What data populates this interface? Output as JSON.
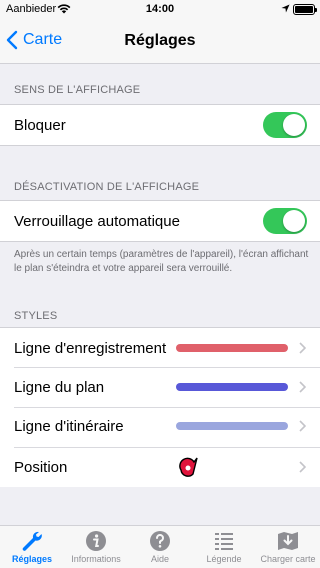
{
  "status": {
    "carrier": "Aanbieder",
    "time": "14:00"
  },
  "nav": {
    "back_label": "Carte",
    "title": "Réglages"
  },
  "sections": {
    "display_direction": {
      "header": "SENS DE L'AFFICHAGE",
      "row_label": "Bloquer",
      "toggle_on": true
    },
    "display_deactivation": {
      "header": "DÉSACTIVATION DE L'AFFICHAGE",
      "row_label": "Verrouillage automatique",
      "toggle_on": true,
      "footer": "Après un certain temps (paramètres de l'appareil), l'écran affichant le plan s'éteindra et votre appareil sera verrouillé."
    },
    "styles": {
      "header": "STYLES",
      "rows": [
        {
          "label": "Ligne d'enregistrement",
          "color": "#e0606a"
        },
        {
          "label": "Ligne du plan",
          "color": "#5858d8"
        },
        {
          "label": "Ligne d'itinéraire",
          "color": "#9aa6de"
        },
        {
          "label": "Position",
          "icon": "location-marker-icon",
          "color": "#e0143c"
        }
      ]
    }
  },
  "tabs": [
    {
      "label": "Réglages",
      "icon": "wrench-icon",
      "active": true
    },
    {
      "label": "Informations",
      "icon": "info-icon",
      "active": false
    },
    {
      "label": "Aide",
      "icon": "help-icon",
      "active": false
    },
    {
      "label": "Légende",
      "icon": "legend-icon",
      "active": false
    },
    {
      "label": "Charger carte",
      "icon": "download-map-icon",
      "active": false
    }
  ],
  "colors": {
    "accent": "#007aff",
    "toggle_on": "#34c759"
  }
}
